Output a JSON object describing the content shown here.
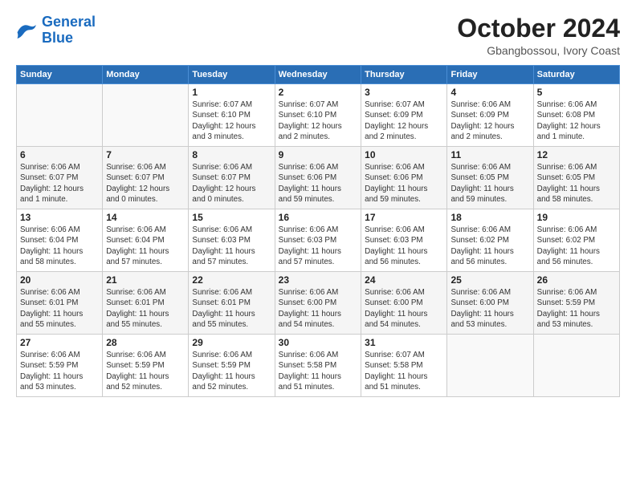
{
  "header": {
    "title": "October 2024",
    "subtitle": "Gbangbossou, Ivory Coast"
  },
  "calendar": {
    "headers": [
      "Sunday",
      "Monday",
      "Tuesday",
      "Wednesday",
      "Thursday",
      "Friday",
      "Saturday"
    ],
    "weeks": [
      [
        {
          "day": "",
          "info": ""
        },
        {
          "day": "",
          "info": ""
        },
        {
          "day": "1",
          "info": "Sunrise: 6:07 AM\nSunset: 6:10 PM\nDaylight: 12 hours\nand 3 minutes."
        },
        {
          "day": "2",
          "info": "Sunrise: 6:07 AM\nSunset: 6:10 PM\nDaylight: 12 hours\nand 2 minutes."
        },
        {
          "day": "3",
          "info": "Sunrise: 6:07 AM\nSunset: 6:09 PM\nDaylight: 12 hours\nand 2 minutes."
        },
        {
          "day": "4",
          "info": "Sunrise: 6:06 AM\nSunset: 6:09 PM\nDaylight: 12 hours\nand 2 minutes."
        },
        {
          "day": "5",
          "info": "Sunrise: 6:06 AM\nSunset: 6:08 PM\nDaylight: 12 hours\nand 1 minute."
        }
      ],
      [
        {
          "day": "6",
          "info": "Sunrise: 6:06 AM\nSunset: 6:07 PM\nDaylight: 12 hours\nand 1 minute."
        },
        {
          "day": "7",
          "info": "Sunrise: 6:06 AM\nSunset: 6:07 PM\nDaylight: 12 hours\nand 0 minutes."
        },
        {
          "day": "8",
          "info": "Sunrise: 6:06 AM\nSunset: 6:07 PM\nDaylight: 12 hours\nand 0 minutes."
        },
        {
          "day": "9",
          "info": "Sunrise: 6:06 AM\nSunset: 6:06 PM\nDaylight: 11 hours\nand 59 minutes."
        },
        {
          "day": "10",
          "info": "Sunrise: 6:06 AM\nSunset: 6:06 PM\nDaylight: 11 hours\nand 59 minutes."
        },
        {
          "day": "11",
          "info": "Sunrise: 6:06 AM\nSunset: 6:05 PM\nDaylight: 11 hours\nand 59 minutes."
        },
        {
          "day": "12",
          "info": "Sunrise: 6:06 AM\nSunset: 6:05 PM\nDaylight: 11 hours\nand 58 minutes."
        }
      ],
      [
        {
          "day": "13",
          "info": "Sunrise: 6:06 AM\nSunset: 6:04 PM\nDaylight: 11 hours\nand 58 minutes."
        },
        {
          "day": "14",
          "info": "Sunrise: 6:06 AM\nSunset: 6:04 PM\nDaylight: 11 hours\nand 57 minutes."
        },
        {
          "day": "15",
          "info": "Sunrise: 6:06 AM\nSunset: 6:03 PM\nDaylight: 11 hours\nand 57 minutes."
        },
        {
          "day": "16",
          "info": "Sunrise: 6:06 AM\nSunset: 6:03 PM\nDaylight: 11 hours\nand 57 minutes."
        },
        {
          "day": "17",
          "info": "Sunrise: 6:06 AM\nSunset: 6:03 PM\nDaylight: 11 hours\nand 56 minutes."
        },
        {
          "day": "18",
          "info": "Sunrise: 6:06 AM\nSunset: 6:02 PM\nDaylight: 11 hours\nand 56 minutes."
        },
        {
          "day": "19",
          "info": "Sunrise: 6:06 AM\nSunset: 6:02 PM\nDaylight: 11 hours\nand 56 minutes."
        }
      ],
      [
        {
          "day": "20",
          "info": "Sunrise: 6:06 AM\nSunset: 6:01 PM\nDaylight: 11 hours\nand 55 minutes."
        },
        {
          "day": "21",
          "info": "Sunrise: 6:06 AM\nSunset: 6:01 PM\nDaylight: 11 hours\nand 55 minutes."
        },
        {
          "day": "22",
          "info": "Sunrise: 6:06 AM\nSunset: 6:01 PM\nDaylight: 11 hours\nand 55 minutes."
        },
        {
          "day": "23",
          "info": "Sunrise: 6:06 AM\nSunset: 6:00 PM\nDaylight: 11 hours\nand 54 minutes."
        },
        {
          "day": "24",
          "info": "Sunrise: 6:06 AM\nSunset: 6:00 PM\nDaylight: 11 hours\nand 54 minutes."
        },
        {
          "day": "25",
          "info": "Sunrise: 6:06 AM\nSunset: 6:00 PM\nDaylight: 11 hours\nand 53 minutes."
        },
        {
          "day": "26",
          "info": "Sunrise: 6:06 AM\nSunset: 5:59 PM\nDaylight: 11 hours\nand 53 minutes."
        }
      ],
      [
        {
          "day": "27",
          "info": "Sunrise: 6:06 AM\nSunset: 5:59 PM\nDaylight: 11 hours\nand 53 minutes."
        },
        {
          "day": "28",
          "info": "Sunrise: 6:06 AM\nSunset: 5:59 PM\nDaylight: 11 hours\nand 52 minutes."
        },
        {
          "day": "29",
          "info": "Sunrise: 6:06 AM\nSunset: 5:59 PM\nDaylight: 11 hours\nand 52 minutes."
        },
        {
          "day": "30",
          "info": "Sunrise: 6:06 AM\nSunset: 5:58 PM\nDaylight: 11 hours\nand 51 minutes."
        },
        {
          "day": "31",
          "info": "Sunrise: 6:07 AM\nSunset: 5:58 PM\nDaylight: 11 hours\nand 51 minutes."
        },
        {
          "day": "",
          "info": ""
        },
        {
          "day": "",
          "info": ""
        }
      ]
    ]
  }
}
